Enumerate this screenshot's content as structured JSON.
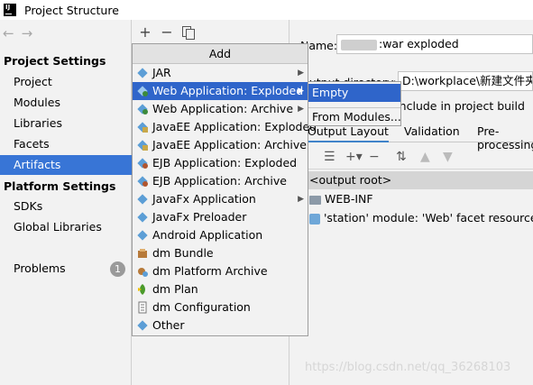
{
  "window": {
    "title": "Project Structure"
  },
  "sidebar": {
    "section_project": "Project Settings",
    "project_items": [
      {
        "label": "Project"
      },
      {
        "label": "Modules"
      },
      {
        "label": "Libraries"
      },
      {
        "label": "Facets"
      },
      {
        "label": "Artifacts",
        "selected": true
      }
    ],
    "section_platform": "Platform Settings",
    "platform_items": [
      {
        "label": "SDKs"
      },
      {
        "label": "Global Libraries"
      }
    ],
    "problems_label": "Problems",
    "problems_count": "1"
  },
  "toolbar": {
    "add": "+",
    "remove": "−"
  },
  "artifact": {
    "name_label": "Name:",
    "name_value": ":war exploded",
    "output_dir_label": "Output directory:",
    "output_dir_value": "D:\\workplace\\新建文件夹\\",
    "build_checkbox_label": "Include in project build"
  },
  "tabs": [
    "Output Layout",
    "Validation",
    "Pre-processing"
  ],
  "layout_tree": [
    {
      "label": "<output root>"
    },
    {
      "label": "WEB-INF"
    },
    {
      "label": "'station' module: 'Web' facet resources"
    }
  ],
  "popup": {
    "header": "Add",
    "items": [
      {
        "label": "JAR",
        "icon": "artifact-diamond-icon",
        "submenu": true
      },
      {
        "label": "Web Application: Exploded",
        "icon": "web-artifact-icon",
        "submenu": true,
        "highlighted": true
      },
      {
        "label": "Web Application: Archive",
        "icon": "web-artifact-icon",
        "submenu": true
      },
      {
        "label": "JavaEE Application: Exploded",
        "icon": "javaee-icon"
      },
      {
        "label": "JavaEE Application: Archive",
        "icon": "javaee-icon"
      },
      {
        "label": "EJB Application: Exploded",
        "icon": "ejb-icon"
      },
      {
        "label": "EJB Application: Archive",
        "icon": "ejb-icon"
      },
      {
        "label": "JavaFx Application",
        "icon": "javafx-icon",
        "submenu": true
      },
      {
        "label": "JavaFx Preloader",
        "icon": "javafx-icon"
      },
      {
        "label": "Android Application",
        "icon": "android-icon"
      },
      {
        "label": "dm Bundle",
        "icon": "dm-bundle-icon"
      },
      {
        "label": "dm Platform Archive",
        "icon": "dm-platform-icon"
      },
      {
        "label": "dm Plan",
        "icon": "dm-plan-icon"
      },
      {
        "label": "dm Configuration",
        "icon": "dm-config-icon"
      },
      {
        "label": "Other",
        "icon": "other-icon"
      }
    ]
  },
  "submenu": {
    "items": [
      {
        "label": "Empty",
        "highlighted": true
      },
      {
        "label": "From Modules..."
      }
    ]
  },
  "watermark": "https://blog.csdn.net/qq_36268103",
  "colors": {
    "selection": "#3875d6",
    "menu_highlight": "#2f65ca"
  }
}
